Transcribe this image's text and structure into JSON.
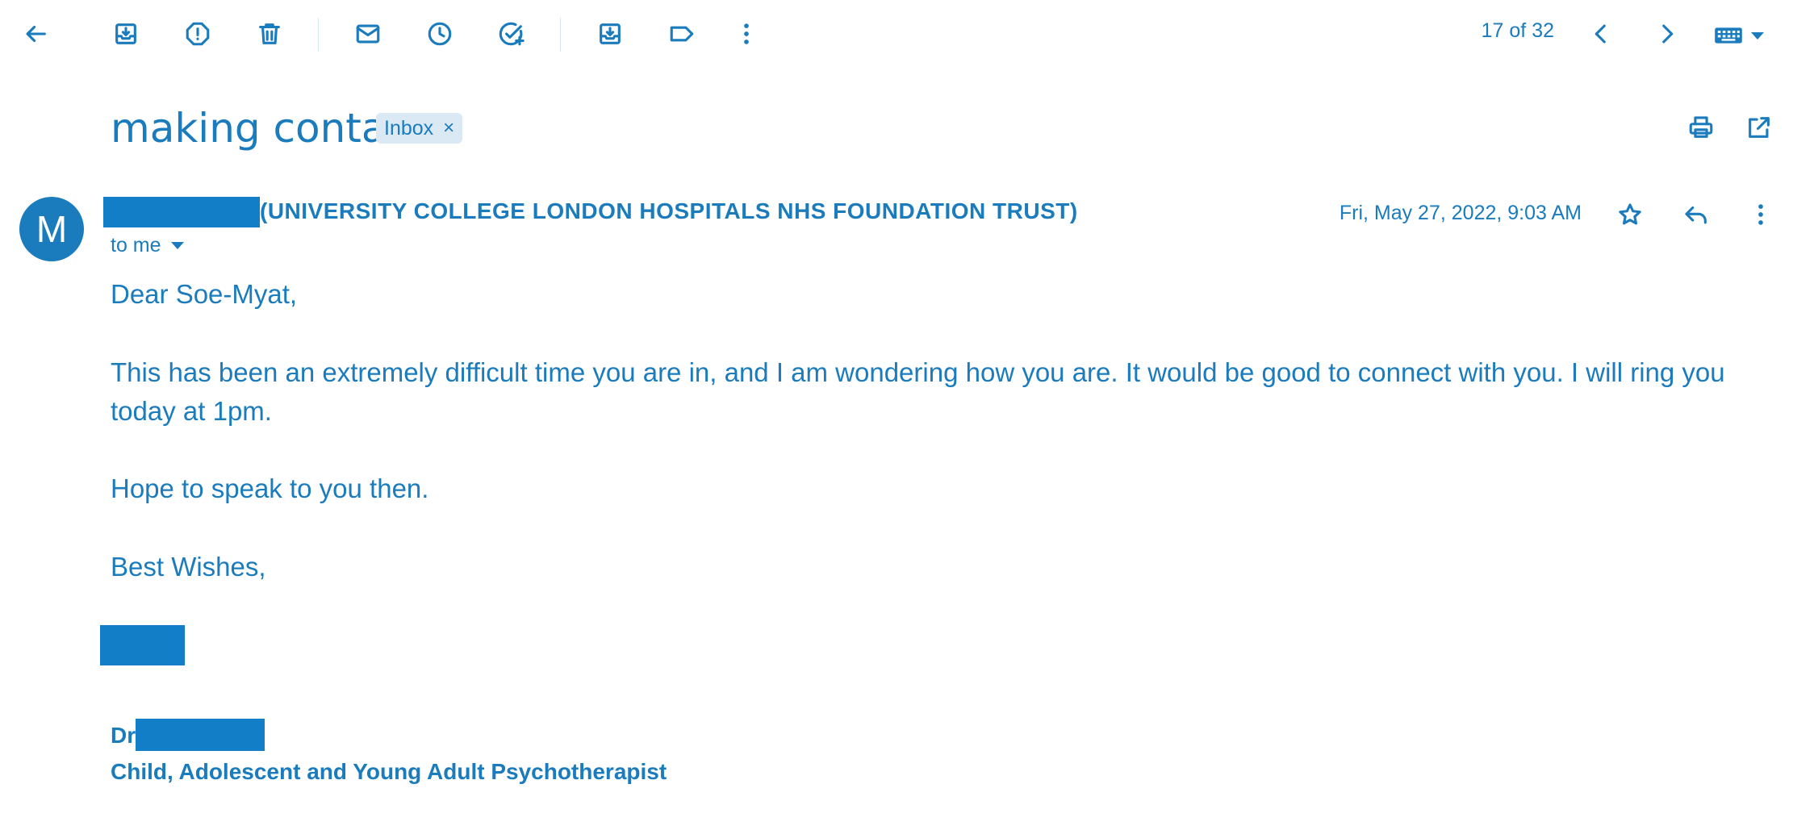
{
  "toolbar": {
    "back_icon": "arrow-left-icon",
    "archive_icon": "archive-icon",
    "report_spam_icon": "report-spam-icon",
    "delete_icon": "trash-icon",
    "mark_unread_icon": "mail-icon",
    "snooze_icon": "clock-icon",
    "add_task_icon": "add-task-icon",
    "move_to_icon": "move-to-inbox-icon",
    "label_icon": "label-icon",
    "more_icon": "more-vert-icon",
    "counter": "17 of 32",
    "prev_icon": "chevron-left-icon",
    "next_icon": "chevron-right-icon",
    "keyboard_icon": "keyboard-icon"
  },
  "message": {
    "subject": "making contact",
    "label_chip": "Inbox",
    "label_remove": "×",
    "avatar_letter": "M",
    "sender_org": "(UNIVERSITY COLLEGE LONDON HOSPITALS NHS FOUNDATION TRUST)",
    "recipient": "to me",
    "date": "Fri, May 27, 2022, 9:03 AM",
    "body": {
      "greeting": "Dear Soe-Myat,",
      "paragraph": "This has been an extremely difficult time you are in, and I am wondering how you are. It would be good to connect with you. I will ring you today at 1pm.",
      "closing_line": "Hope to speak to you then.",
      "sign_off": "Best Wishes,"
    },
    "signature": {
      "prefix": "Dr",
      "title": "Child, Adolescent and Young Adult Psychotherapist"
    }
  },
  "colors": {
    "accent": "#1a7bbd",
    "redaction": "#137ec8",
    "chip_bg": "#dbe9f5"
  }
}
